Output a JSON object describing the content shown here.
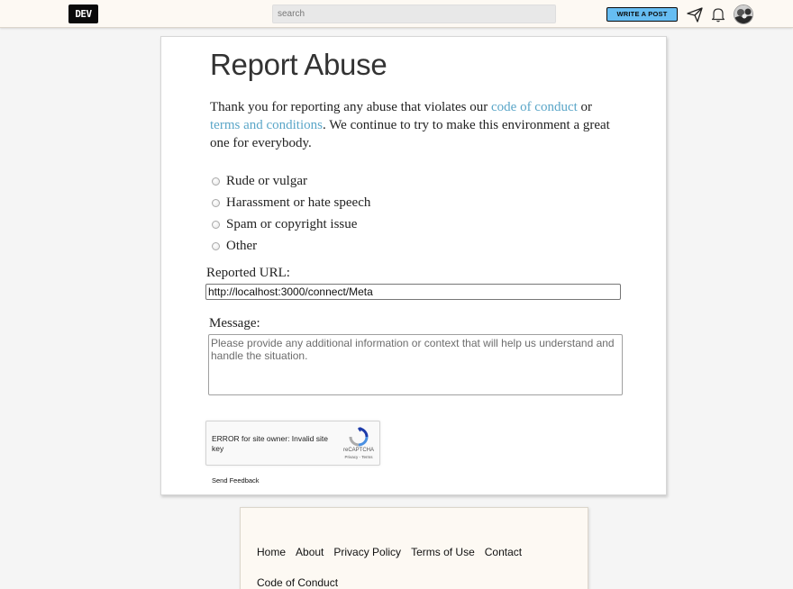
{
  "header": {
    "logo_text": "DEV",
    "search_placeholder": "search",
    "write_post_label": "WRITE A POST",
    "icons": [
      "paper-plane-icon",
      "bell-icon",
      "avatar"
    ],
    "accent_color": "#66bdf2"
  },
  "report": {
    "title": "Report Abuse",
    "intro_prefix": "Thank you for reporting any abuse that violates our",
    "code_of_conduct_link": "code of conduct",
    "intro_or": "or",
    "terms_link": "terms and conditions",
    "intro_suffix": ". We continue to try to make this environment a great one for everybody.",
    "options": [
      {
        "label": "Rude or vulgar",
        "checked": false
      },
      {
        "label": "Harassment or hate speech",
        "checked": false
      },
      {
        "label": "Spam or copyright issue",
        "checked": false
      },
      {
        "label": "Other",
        "checked": false
      }
    ],
    "url_label": "Reported URL:",
    "url_value": "http://localhost:3000/connect/Meta",
    "message_label": "Message:",
    "message_placeholder": "Please provide any additional information or context that will help us understand and handle the situation.",
    "message_value": ""
  },
  "recaptcha": {
    "error_text": "ERROR for site owner: Invalid site key",
    "brand": "reCAPTCHA",
    "links": "Privacy - Terms"
  },
  "send_feedback_label": "Send Feedback",
  "footer": {
    "links": [
      "Home",
      "About",
      "Privacy Policy",
      "Terms of Use",
      "Contact"
    ],
    "links_row2": [
      "Code of Conduct"
    ]
  }
}
